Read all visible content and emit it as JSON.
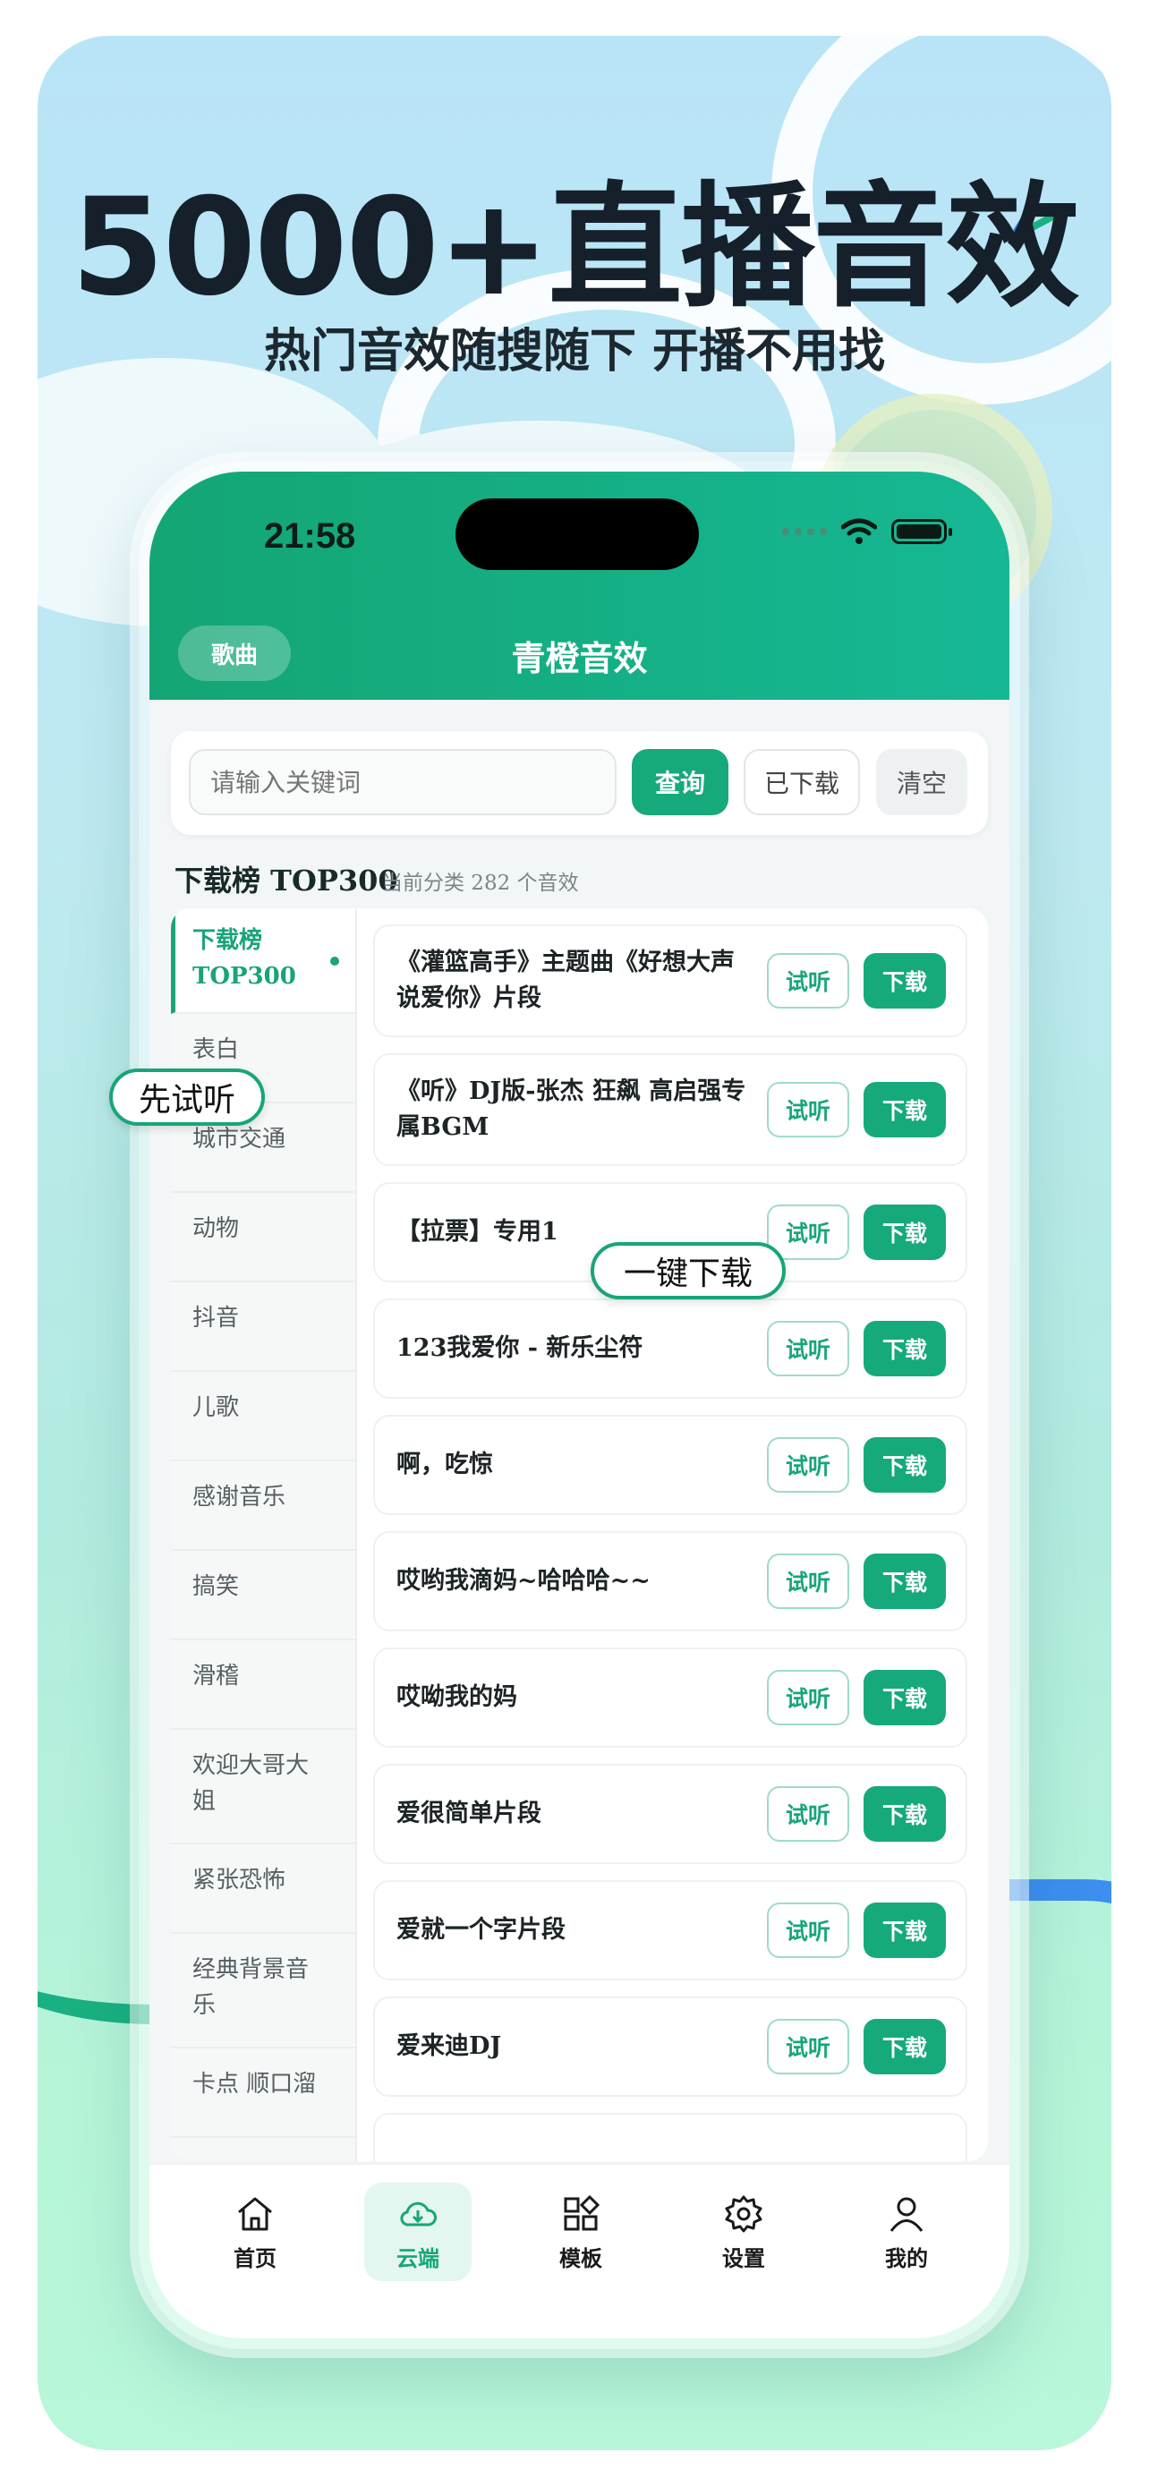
{
  "poster": {
    "headline": "5000+直播音效",
    "subhead": "热门音效随搜随下   开播不用找"
  },
  "status": {
    "time": "21:58"
  },
  "header": {
    "song_button": "歌曲",
    "title": "青橙音效"
  },
  "search": {
    "placeholder": "请输入关键词",
    "query_label": "查询",
    "downloaded_label": "已下载",
    "clear_label": "清空"
  },
  "section": {
    "title": "下载榜 TOP300",
    "subtitle": "当前分类 282 个音效"
  },
  "categories": [
    "下载榜\nTOP300",
    "表白",
    "城市交通",
    "动物",
    "抖音",
    "儿歌",
    "感谢音乐",
    "搞笑",
    "滑稽",
    "欢迎大哥大\n姐",
    "紧张恐怖",
    "经典背景音\n乐",
    "卡点 顺口溜"
  ],
  "sounds": [
    "《灌篮高手》主题曲《好想大声说爱你》片段",
    "《听》DJ版-张杰 狂飙 高启强专属BGM",
    "【拉票】专用1",
    "123我爱你 - 新乐尘符",
    "啊，吃惊",
    "哎哟我滴妈~哈哈哈~~",
    "哎呦我的妈",
    "爱很简单片段",
    "爱就一个字片段",
    "爱来迪DJ"
  ],
  "actions": {
    "try_label": "试听",
    "download_label": "下载"
  },
  "tabs": [
    "首页",
    "云端",
    "模板",
    "设置",
    "我的"
  ],
  "callouts": {
    "try_first": "先试听",
    "one_click": "一键下载"
  },
  "colors": {
    "accent": "#16a97c",
    "header": "#15b085"
  }
}
